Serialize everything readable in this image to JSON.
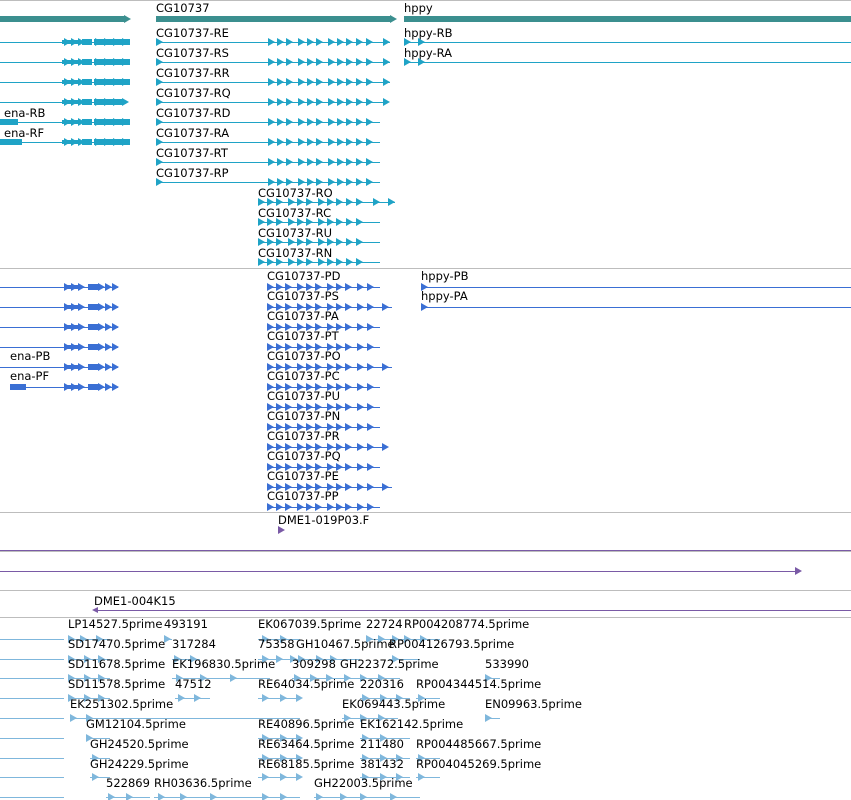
{
  "colors": {
    "gene": "#3b8f8f",
    "transcript": "#1fa3c6",
    "protein": "#3a6fd4",
    "clone": "#7a5aa6",
    "est": "#7fb7dc",
    "separator": "#bdbdbd"
  },
  "tracks": {
    "genes": {
      "features": [
        {
          "label": "",
          "color": "gene"
        },
        {
          "label": "CG10737",
          "color": "gene"
        },
        {
          "label": "hppy",
          "color": "gene"
        }
      ]
    },
    "transcripts": {
      "features": [
        {
          "label": "",
          "color": "transcript"
        },
        {
          "label": "CG10737-RE",
          "color": "transcript"
        },
        {
          "label": "hppy-RB",
          "color": "transcript"
        },
        {
          "label": "",
          "color": "transcript"
        },
        {
          "label": "CG10737-RS",
          "color": "transcript"
        },
        {
          "label": "hppy-RA",
          "color": "transcript"
        },
        {
          "label": "",
          "color": "transcript"
        },
        {
          "label": "CG10737-RR",
          "color": "transcript"
        },
        {
          "label": "",
          "color": "transcript"
        },
        {
          "label": "CG10737-RQ",
          "color": "transcript"
        },
        {
          "label": "ena-RB",
          "color": "transcript"
        },
        {
          "label": "CG10737-RD",
          "color": "transcript"
        },
        {
          "label": "ena-RF",
          "color": "transcript"
        },
        {
          "label": "CG10737-RA",
          "color": "transcript"
        },
        {
          "label": "CG10737-RT",
          "color": "transcript"
        },
        {
          "label": "CG10737-RP",
          "color": "transcript"
        },
        {
          "label": "CG10737-RO",
          "color": "transcript"
        },
        {
          "label": "CG10737-RC",
          "color": "transcript"
        },
        {
          "label": "CG10737-RU",
          "color": "transcript"
        },
        {
          "label": "CG10737-RN",
          "color": "transcript"
        }
      ]
    },
    "proteins": {
      "features": [
        {
          "label": "",
          "color": "protein"
        },
        {
          "label": "CG10737-PD",
          "color": "protein"
        },
        {
          "label": "hppy-PB",
          "color": "protein"
        },
        {
          "label": "",
          "color": "protein"
        },
        {
          "label": "CG10737-PS",
          "color": "protein"
        },
        {
          "label": "hppy-PA",
          "color": "protein"
        },
        {
          "label": "",
          "color": "protein"
        },
        {
          "label": "CG10737-PA",
          "color": "protein"
        },
        {
          "label": "",
          "color": "protein"
        },
        {
          "label": "CG10737-PT",
          "color": "protein"
        },
        {
          "label": "ena-PB",
          "color": "protein"
        },
        {
          "label": "CG10737-PO",
          "color": "protein"
        },
        {
          "label": "ena-PF",
          "color": "protein"
        },
        {
          "label": "CG10737-PC",
          "color": "protein"
        },
        {
          "label": "CG10737-PU",
          "color": "protein"
        },
        {
          "label": "CG10737-PN",
          "color": "protein"
        },
        {
          "label": "CG10737-PR",
          "color": "protein"
        },
        {
          "label": "CG10737-PQ",
          "color": "protein"
        },
        {
          "label": "CG10737-PE",
          "color": "protein"
        },
        {
          "label": "CG10737-PP",
          "color": "protein"
        }
      ]
    },
    "clones": {
      "features": [
        {
          "label": "DME1-019P03.F",
          "color": "clone"
        },
        {
          "label": "",
          "color": "clone"
        },
        {
          "label": "",
          "color": "clone"
        }
      ]
    },
    "bac": {
      "features": [
        {
          "label": "DME1-004K15",
          "color": "clone"
        }
      ]
    },
    "ests": {
      "features": [
        {
          "label": "LP14527.5prime"
        },
        {
          "label": "493191"
        },
        {
          "label": "EK067039.5prime"
        },
        {
          "label": "22724"
        },
        {
          "label": "RP004208774.5prime"
        },
        {
          "label": "SD17470.5prime"
        },
        {
          "label": "317284"
        },
        {
          "label": "75358"
        },
        {
          "label": "GH10467.5prime"
        },
        {
          "label": "RP004126793.5prime"
        },
        {
          "label": "SD11678.5prime"
        },
        {
          "label": "EK196830.5prime"
        },
        {
          "label": "309298"
        },
        {
          "label": "GH22372.5prime"
        },
        {
          "label": "533990"
        },
        {
          "label": "SD11578.5prime"
        },
        {
          "label": "47512"
        },
        {
          "label": "RE64034.5prime"
        },
        {
          "label": "220316"
        },
        {
          "label": "RP004344514.5prime"
        },
        {
          "label": "EK251302.5prime"
        },
        {
          "label": "EK069443.5prime"
        },
        {
          "label": "EN09963.5prime"
        },
        {
          "label": "GM12104.5prime"
        },
        {
          "label": "RE40896.5prime"
        },
        {
          "label": "EK162142.5prime"
        },
        {
          "label": "GH24520.5prime"
        },
        {
          "label": "RE63464.5prime"
        },
        {
          "label": "211480"
        },
        {
          "label": "RP004485667.5prime"
        },
        {
          "label": "GH24229.5prime"
        },
        {
          "label": "RE68185.5prime"
        },
        {
          "label": "381432"
        },
        {
          "label": "RP004045269.5prime"
        },
        {
          "label": "522869"
        },
        {
          "label": "RH03636.5prime"
        },
        {
          "label": "GH22003.5prime"
        }
      ]
    }
  }
}
